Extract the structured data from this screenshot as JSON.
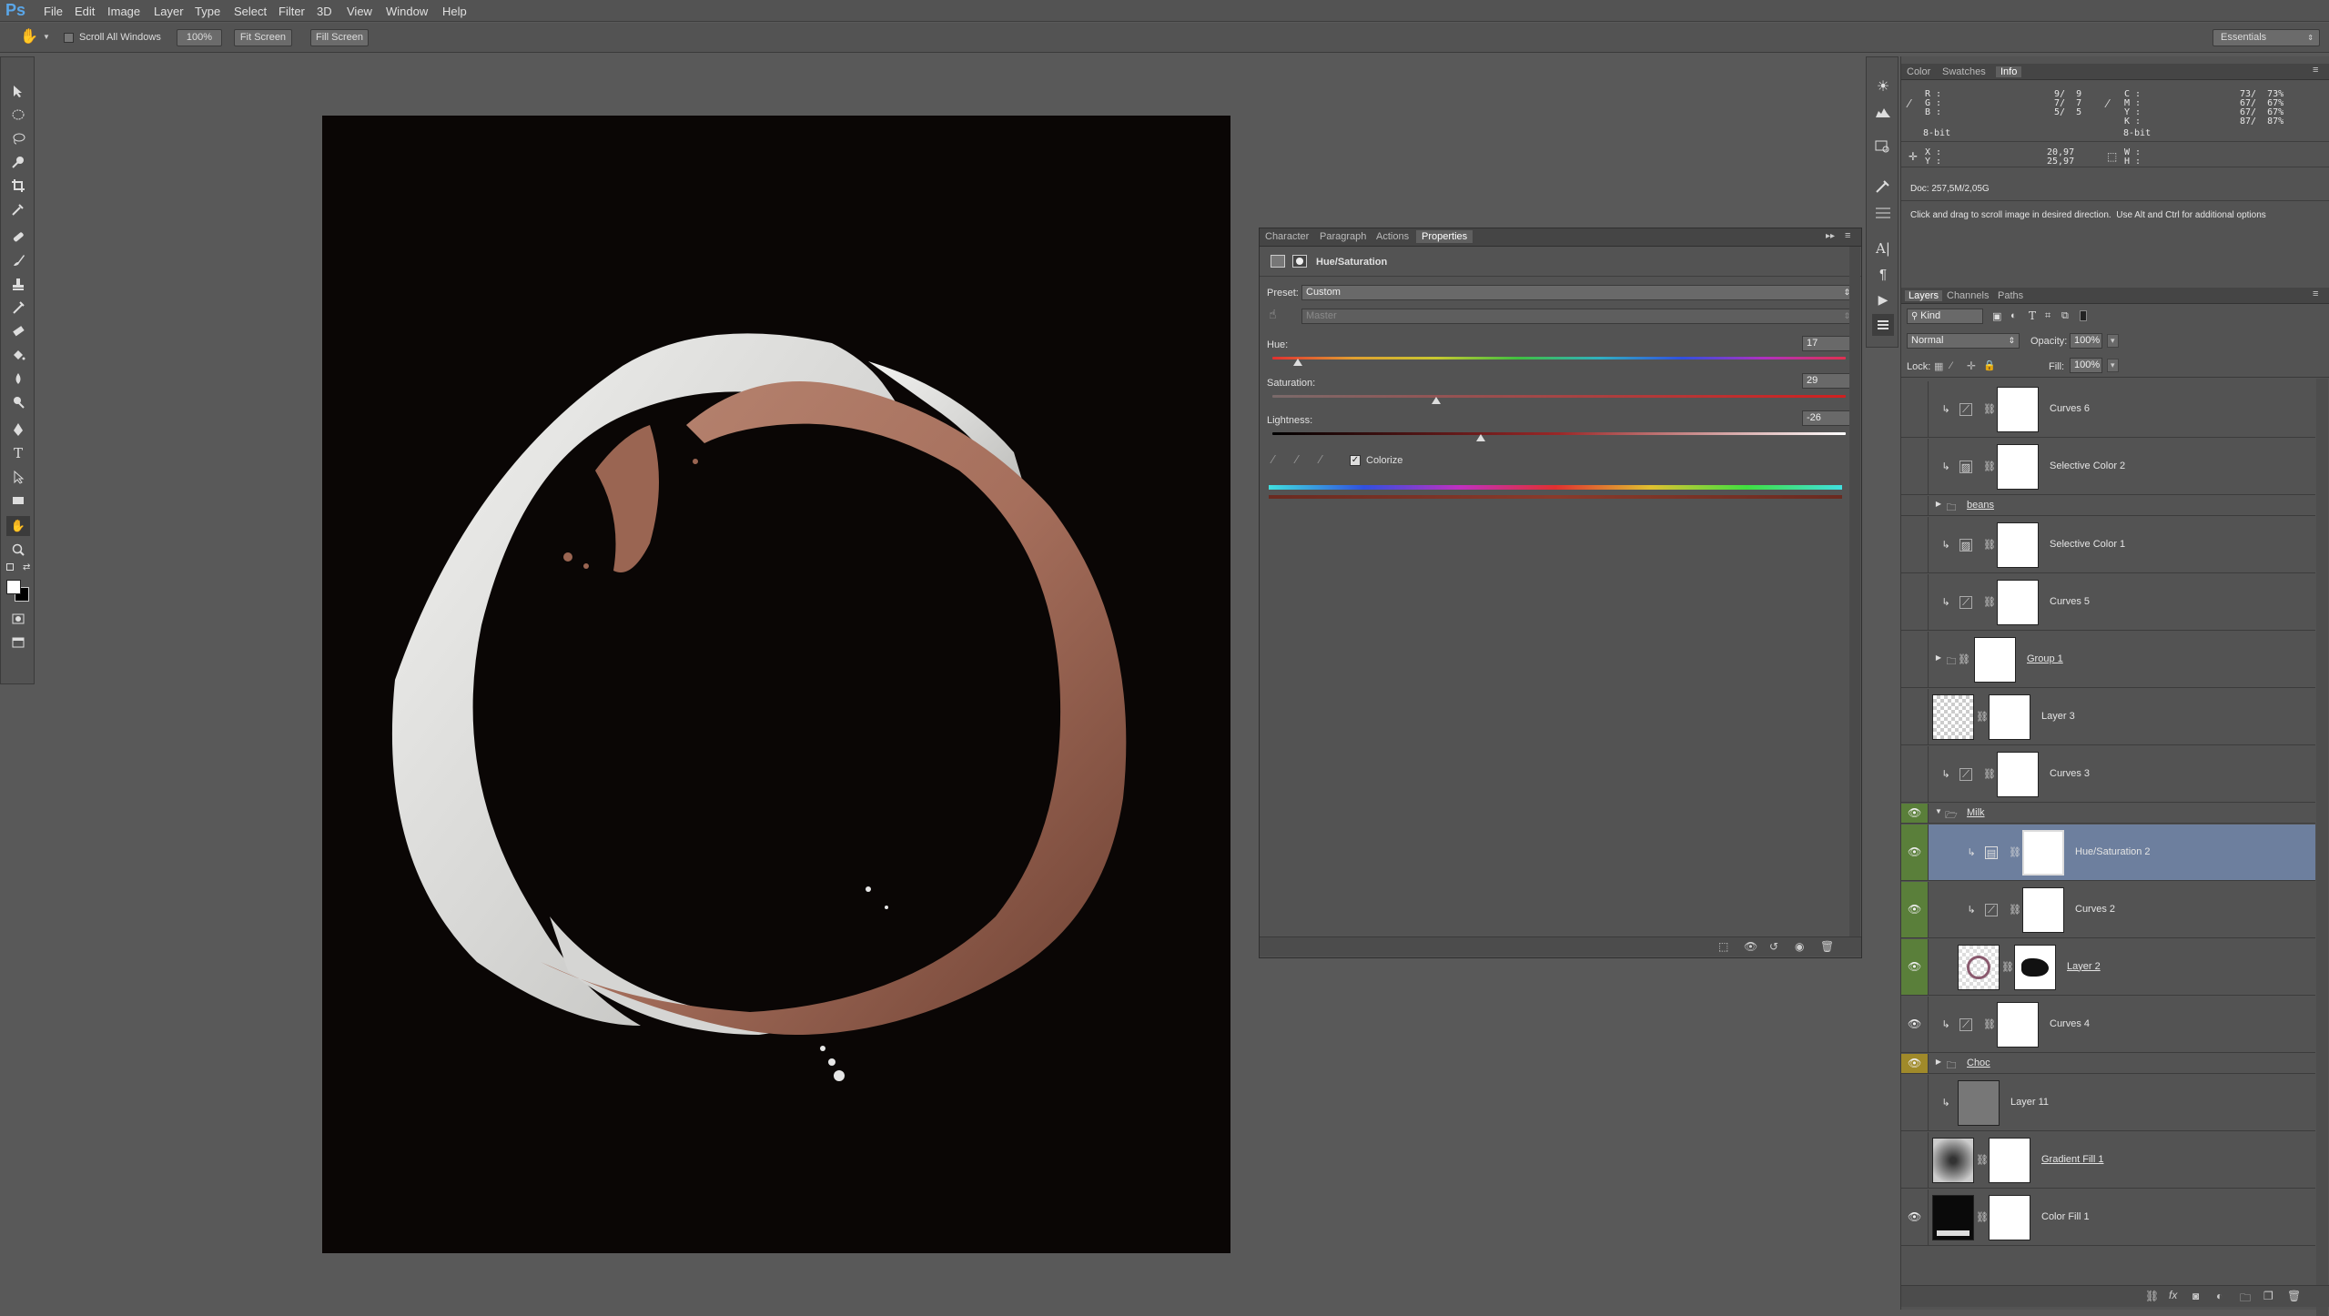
{
  "menubar": {
    "logo": "Ps",
    "items": [
      "File",
      "Edit",
      "Image",
      "Layer",
      "Type",
      "Select",
      "Filter",
      "3D",
      "View",
      "Window",
      "Help"
    ]
  },
  "options": {
    "scroll_all": "Scroll All Windows",
    "zoom_btn": "100%",
    "fit_btn": "Fit Screen",
    "fill_btn": "Fill Screen",
    "workspace": "Essentials"
  },
  "properties": {
    "tabs": [
      "Character",
      "Paragraph",
      "Actions",
      "Properties"
    ],
    "title": "Hue/Saturation",
    "preset_label": "Preset:",
    "preset_value": "Custom",
    "channel_value": "Master",
    "hue_label": "Hue:",
    "hue_value": "17",
    "saturation_label": "Saturation:",
    "saturation_value": "29",
    "lightness_label": "Lightness:",
    "lightness_value": "-26",
    "colorize_label": "Colorize",
    "colorize_checked": true
  },
  "info_panel": {
    "tabs": [
      "Color",
      "Swatches",
      "Info"
    ],
    "rgb_labels": "R :\nG :\nB :",
    "rgb_values": "9/  9\n7/  7\n5/  5",
    "cmyk_labels": "C :\nM :\nY :\nK :",
    "cmyk_values": "73/  73%\n67/  67%\n67/  67%\n87/  87%",
    "bit_left": "8-bit",
    "bit_right": "8-bit",
    "xy_labels": "X :\nY :",
    "xy_values": "20,97\n25,97",
    "wh_labels": "W :\nH :",
    "doc": "Doc: 257,5M/2,05G",
    "hint": "Click and drag to scroll image in desired direction.  Use Alt and Ctrl for additional options"
  },
  "layers_panel": {
    "tabs": [
      "Layers",
      "Channels",
      "Paths"
    ],
    "kind": "Kind",
    "blend_mode": "Normal",
    "opacity_label": "Opacity:",
    "opacity_value": "100%",
    "lock_label": "Lock:",
    "fill_label": "Fill:",
    "fill_value": "100%",
    "layers": [
      {
        "name": "Curves 6",
        "kind": "curves",
        "visible": false
      },
      {
        "name": "Selective Color 2",
        "kind": "selective",
        "visible": false
      },
      {
        "name": "beans",
        "kind": "group",
        "visible": false
      },
      {
        "name": "Selective Color 1",
        "kind": "selective",
        "visible": false
      },
      {
        "name": "Curves 5",
        "kind": "curves",
        "visible": false
      },
      {
        "name": "Group 1",
        "kind": "groupmask",
        "visible": false
      },
      {
        "name": "Layer 3",
        "kind": "pixel",
        "visible": false
      },
      {
        "name": "Curves 3",
        "kind": "curves",
        "visible": false
      },
      {
        "name": "Milk",
        "kind": "group",
        "visible": true
      },
      {
        "name": "Hue/Saturation 2",
        "kind": "huesat",
        "visible": true
      },
      {
        "name": "Curves 2",
        "kind": "curves",
        "visible": true
      },
      {
        "name": "Layer 2",
        "kind": "pixel",
        "visible": true
      },
      {
        "name": "Curves 4",
        "kind": "curves",
        "visible": true
      },
      {
        "name": "Choc",
        "kind": "group",
        "visible": true
      },
      {
        "name": "Layer 11",
        "kind": "pixel",
        "visible": false
      },
      {
        "name": "Gradient Fill 1",
        "kind": "gradient",
        "visible": false
      },
      {
        "name": "Color Fill 1",
        "kind": "colorfill",
        "visible": true
      }
    ]
  }
}
